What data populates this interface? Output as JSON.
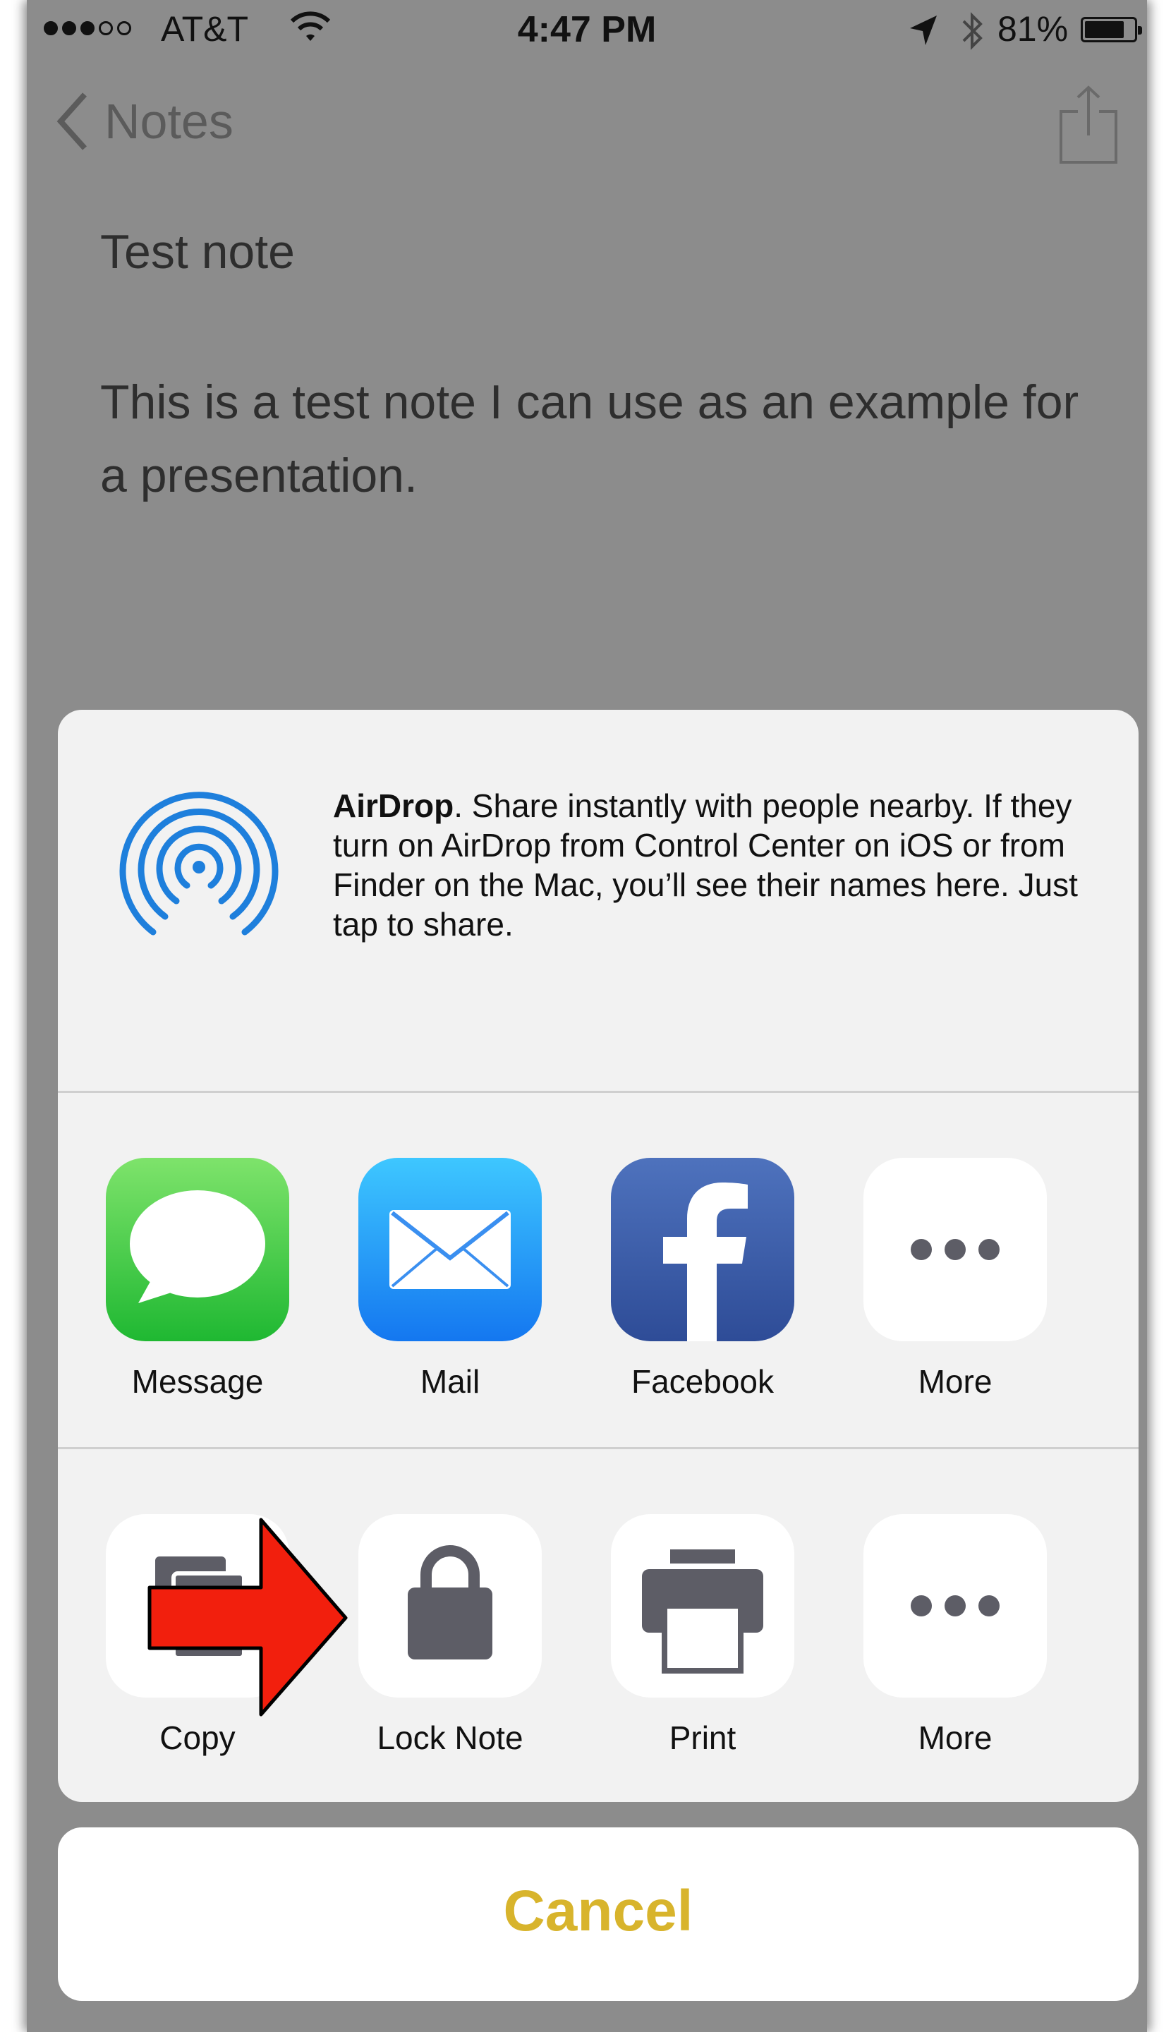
{
  "status_bar": {
    "carrier": "AT&T",
    "time": "4:47 PM",
    "battery": "81%",
    "battery_level": 0.81,
    "signal_bars_filled": 3,
    "signal_bars_total": 5
  },
  "nav": {
    "back_label": "Notes",
    "share_icon": "share-icon"
  },
  "note": {
    "title": "Test note",
    "body": "This is a test note I can use as an example for a presentation."
  },
  "share_sheet": {
    "airdrop": {
      "icon": "airdrop-icon",
      "title": "AirDrop",
      "description": ". Share instantly with people nearby. If they turn on AirDrop from Control Center on iOS or from Finder on the Mac, you’ll see their names here. Just tap to share."
    },
    "apps": [
      {
        "label": "Message",
        "icon": "messages-icon"
      },
      {
        "label": "Mail",
        "icon": "mail-icon"
      },
      {
        "label": "Facebook",
        "icon": "facebook-icon"
      },
      {
        "label": "More",
        "icon": "more-icon"
      }
    ],
    "actions": [
      {
        "label": "Copy",
        "icon": "copy-icon"
      },
      {
        "label": "Lock Note",
        "icon": "lock-icon"
      },
      {
        "label": "Print",
        "icon": "print-icon"
      },
      {
        "label": "More",
        "icon": "more-icon"
      }
    ],
    "cancel_label": "Cancel"
  },
  "colors": {
    "overlay": "#8c8c8c",
    "sheet": "#f2f2f2",
    "cancel_text": "#d8b42c",
    "annotation_arrow": "#f21f0d"
  }
}
